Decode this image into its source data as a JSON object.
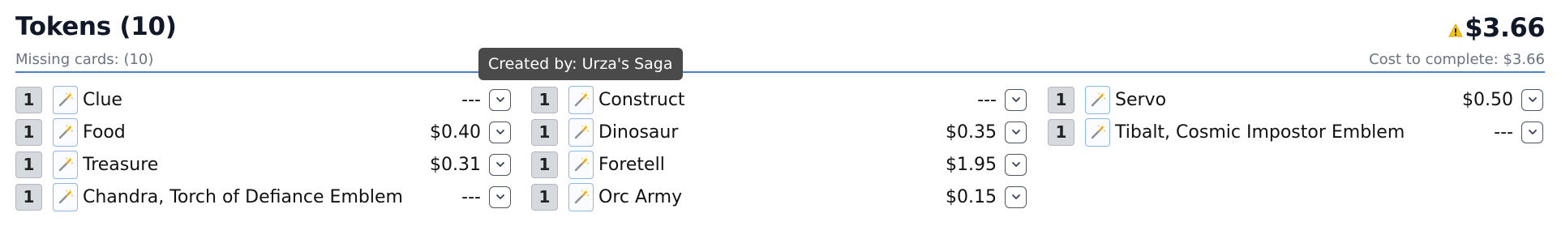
{
  "section": {
    "title": "Tokens (10)",
    "missing": "Missing cards: (10)",
    "total": "$3.66",
    "cost_to_complete": "Cost to complete: $3.66"
  },
  "tooltip": {
    "text": "Created by: Urza's Saga"
  },
  "columns": [
    [
      {
        "qty": "1",
        "name": "Clue",
        "price": "---"
      },
      {
        "qty": "1",
        "name": "Food",
        "price": "$0.40"
      },
      {
        "qty": "1",
        "name": "Treasure",
        "price": "$0.31"
      },
      {
        "qty": "1",
        "name": "Chandra, Torch of Defiance Emblem",
        "price": "---"
      }
    ],
    [
      {
        "qty": "1",
        "name": "Construct",
        "price": "---"
      },
      {
        "qty": "1",
        "name": "Dinosaur",
        "price": "$0.35"
      },
      {
        "qty": "1",
        "name": "Foretell",
        "price": "$1.95"
      },
      {
        "qty": "1",
        "name": "Orc Army",
        "price": "$0.15"
      }
    ],
    [
      {
        "qty": "1",
        "name": "Servo",
        "price": "$0.50"
      },
      {
        "qty": "1",
        "name": "Tibalt, Cosmic Impostor Emblem",
        "price": "---"
      }
    ]
  ],
  "icons": {
    "row_action": "magic-wand-icon",
    "row_menu": "chevron-down-icon",
    "warning": "warning-icon"
  },
  "colors": {
    "divider": "#4a7fd0",
    "warning": "#f5c518",
    "tooltip_bg": "#4a4a4a"
  }
}
